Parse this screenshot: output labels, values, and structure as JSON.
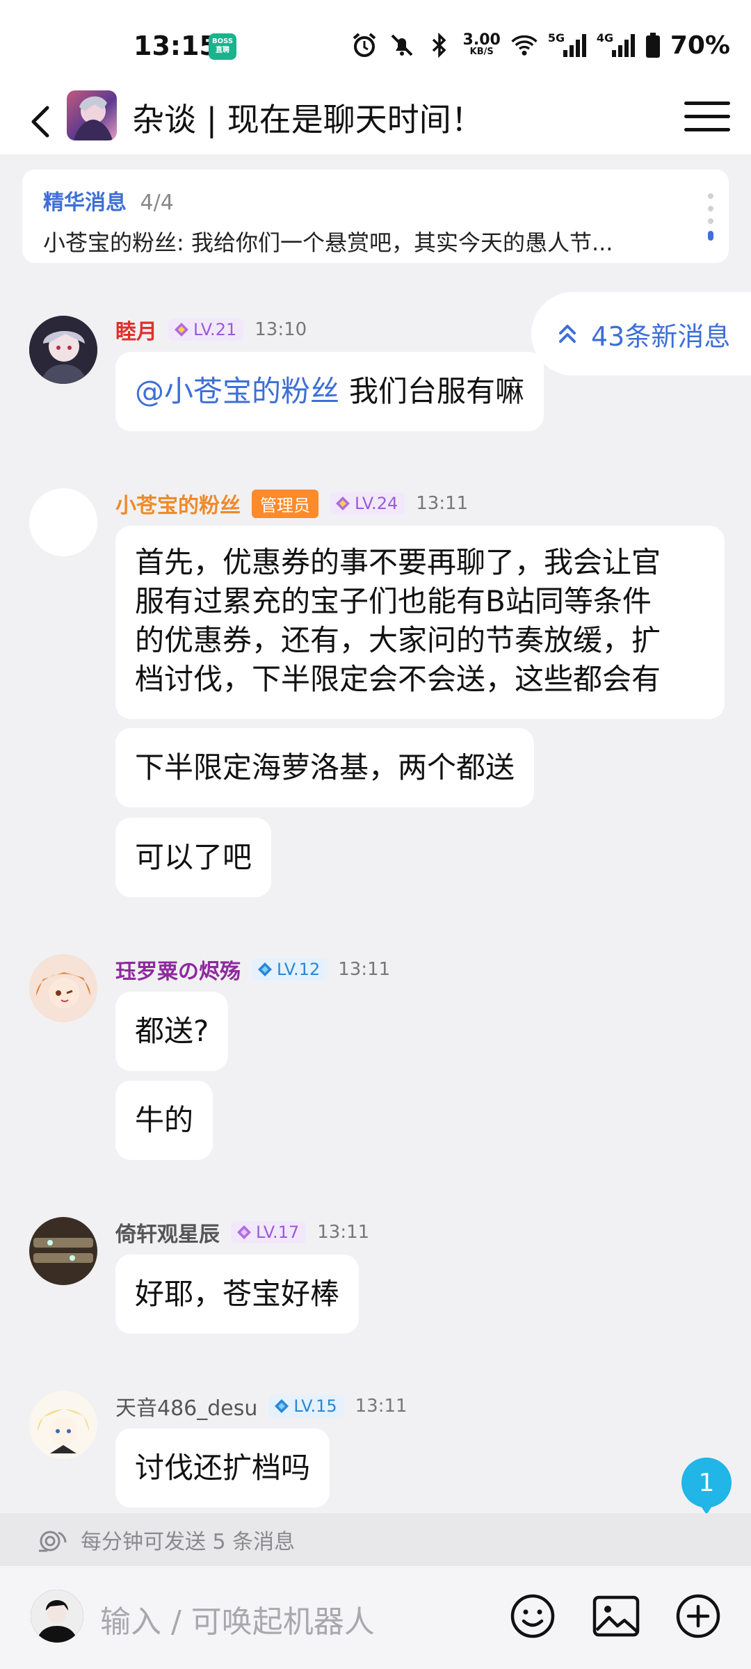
{
  "status_bar": {
    "time": "13:15",
    "boss_badge": [
      "BOSS",
      "直聘"
    ],
    "net_speed": "3.00",
    "net_unit": "KB/S",
    "sim1": "5G",
    "sim2": "4G",
    "battery": "70%"
  },
  "header": {
    "title": "杂谈 | 现在是聊天时间！"
  },
  "pinned": {
    "label": "精华消息",
    "count": "4/4",
    "text": "小苍宝的粉丝: 我给你们一个悬赏吧，其实今天的愚人节..."
  },
  "new_messages": {
    "label": "43条新消息"
  },
  "messages": [
    {
      "name": "睦月",
      "name_color": "#e0302a",
      "level": "LV.21",
      "time": "13:10",
      "mention": "@小苍宝的粉丝",
      "bubbles": [
        "我们台服有嘛"
      ]
    },
    {
      "name": "小苍宝的粉丝",
      "name_color": "#f08a2a",
      "badge": "管理员",
      "level": "LV.24",
      "time": "13:11",
      "bubbles": [
        [
          "首先，优惠券的事不要再聊了，我会让官",
          "服有过累充的宝子们也能有B站同等条件",
          "的优惠券，还有，大家问的节奏放缓，扩",
          "档讨伐，下半限定会不会送，这些都会有"
        ],
        "下半限定海萝洛基，两个都送",
        "可以了吧"
      ]
    },
    {
      "name": "珏罗粟の烬殇",
      "name_color": "#8e2a9e",
      "level": "LV.12",
      "time": "13:11",
      "bubbles": [
        "都送?",
        "牛的"
      ]
    },
    {
      "name": "倚轩观星辰",
      "name_color": "#555555",
      "level": "LV.17",
      "time": "13:11",
      "bubbles": [
        "好耶，苍宝好棒"
      ]
    },
    {
      "name": "天音486_desu",
      "name_color": "#555555",
      "level": "LV.15",
      "time": "13:11",
      "bubbles": [
        "讨伐还扩档吗"
      ]
    }
  ],
  "unread_count": "1",
  "rate_limit": "每分钟可发送 5 条消息",
  "input": {
    "placeholder": "输入 / 可唤起机器人"
  },
  "colors": {
    "accent": "#3d6fd6",
    "background": "#f1f1f3",
    "admin_badge": "#ff8a2a",
    "unread": "#21b5e8"
  },
  "icons": [
    "back-icon",
    "menu-icon",
    "alarm-icon",
    "mute-icon",
    "bluetooth-icon",
    "wifi-icon",
    "signal-icon",
    "battery-icon",
    "chevron-up-double-icon",
    "emoji-icon",
    "image-icon",
    "plus-icon",
    "rate-limit-icon"
  ]
}
